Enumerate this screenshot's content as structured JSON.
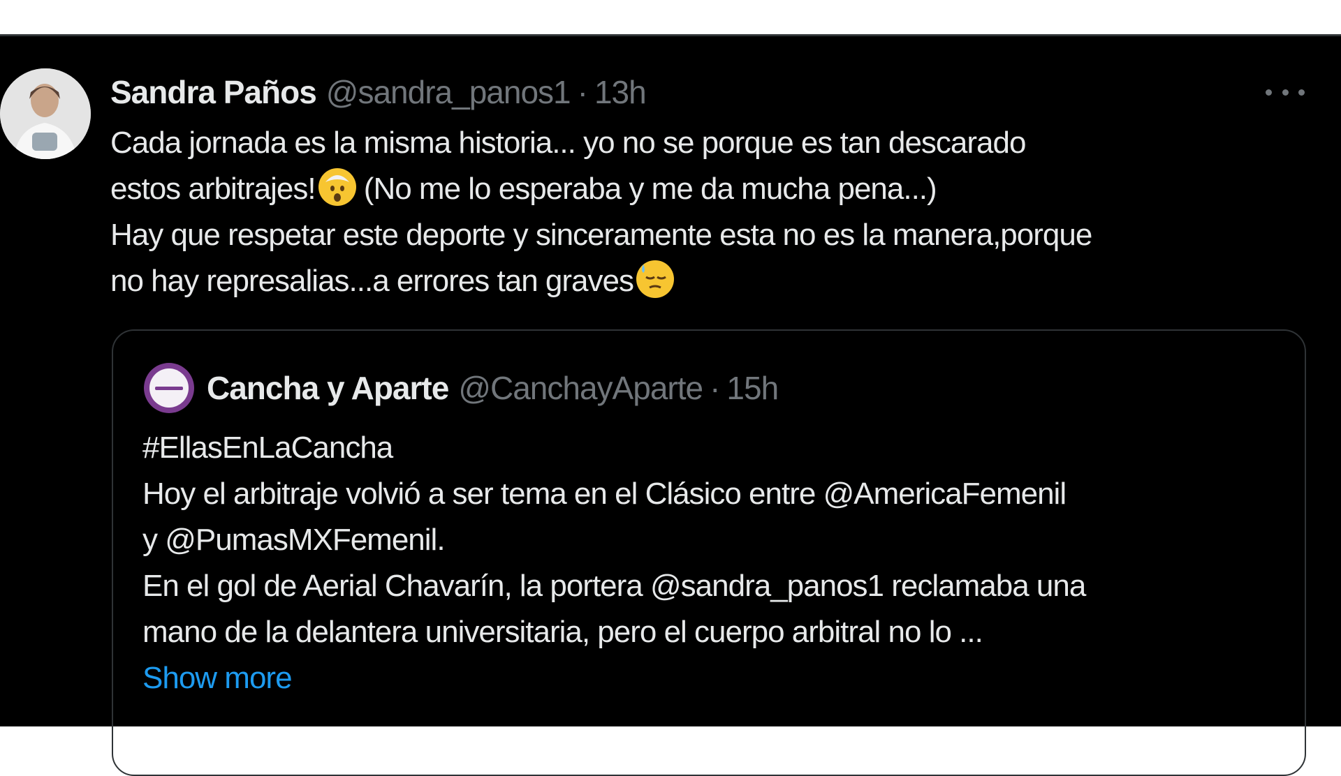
{
  "tweet": {
    "author_name": "Sandra Paños",
    "author_handle": "@sandra_panos1",
    "separator": "·",
    "time": "13h",
    "more_icon": "more-horizontal-icon",
    "lines": [
      {
        "text": "Cada jornada es la misma historia... yo no se porque es tan descarado"
      },
      {
        "text": "estos arbitrajes!",
        "emoji": "exploding-head-emoji",
        "after": " (No me lo esperaba y me da mucha pena...)"
      },
      {
        "text": "Hay que respetar este deporte y sinceramente esta no es la manera,porque"
      },
      {
        "text": "no hay represalias...a errores tan graves",
        "emoji": "downcast-sweat-emoji"
      }
    ]
  },
  "quoted_tweet": {
    "author_name": "Cancha y Aparte",
    "author_handle": "@CanchayAparte",
    "separator": "·",
    "time": "15h",
    "lines": [
      "#EllasEnLaCancha",
      "Hoy el arbitraje volvió a ser tema en el Clásico entre  @AmericaFemenil",
      "y @PumasMXFemenil.",
      "En el gol de Aerial Chavarín, la portera @sandra_panos1 reclamaba una",
      "mano de la delantera universitaria, pero el cuerpo arbitral no lo ..."
    ],
    "show_more": "Show more"
  },
  "colors": {
    "background": "#000000",
    "text": "#e7e9ea",
    "muted": "#71767b",
    "link": "#1d9bf0",
    "border": "#2f3336"
  }
}
